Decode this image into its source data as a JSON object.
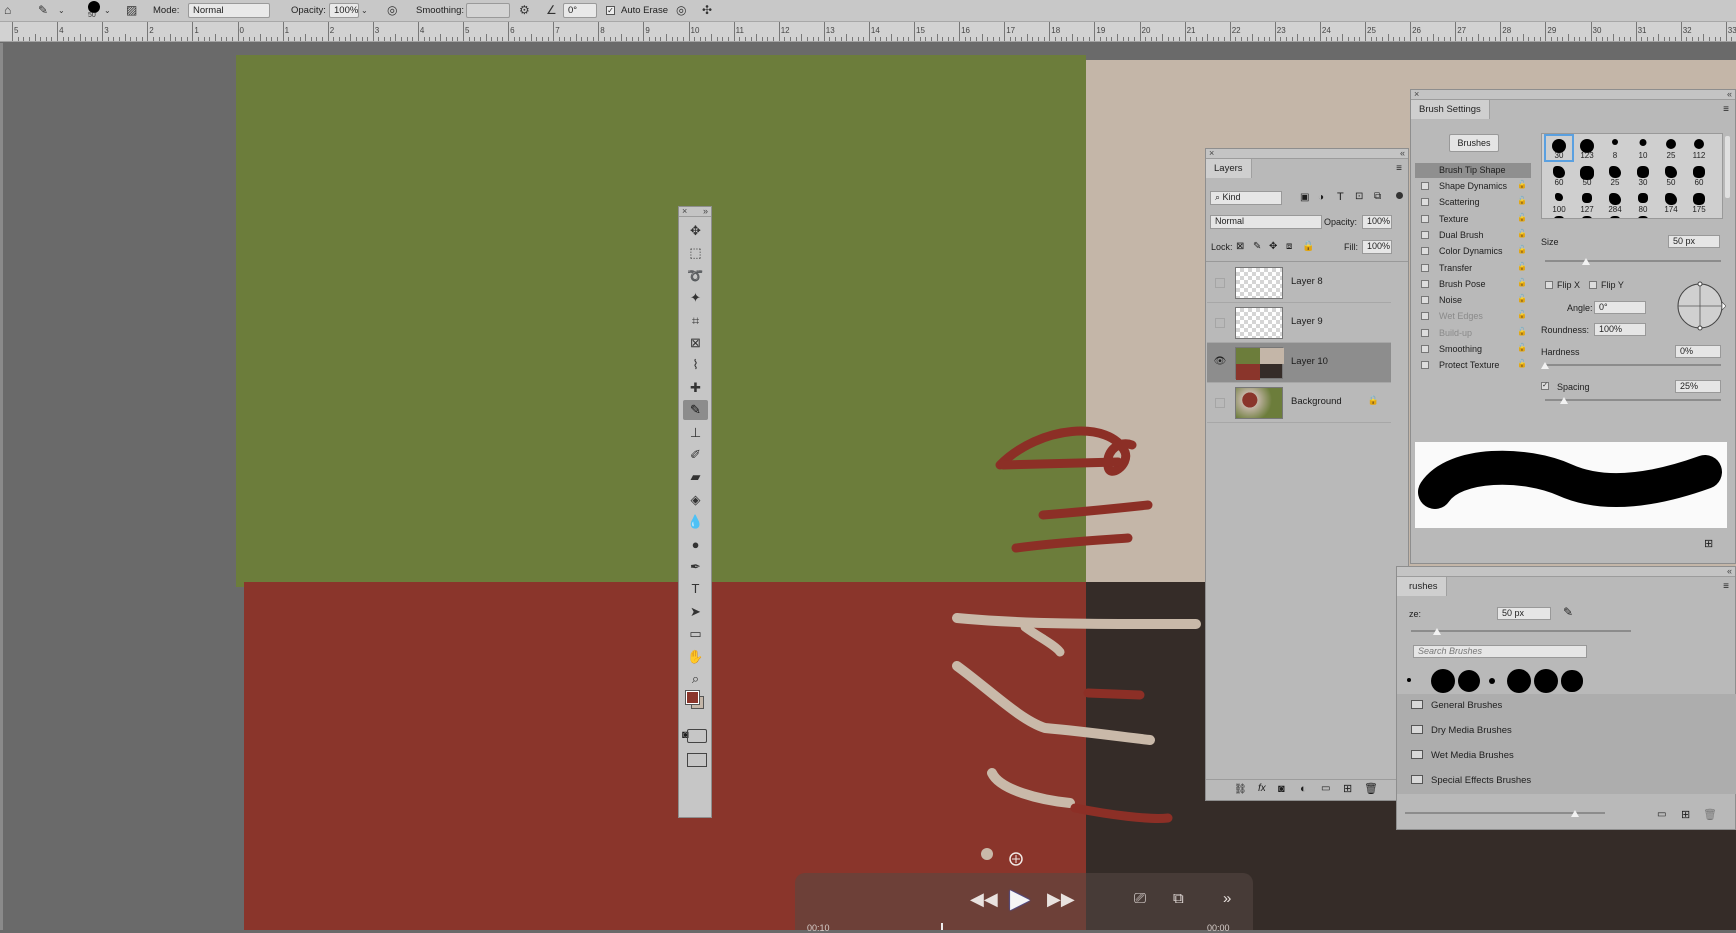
{
  "options_bar": {
    "brush_size": "50",
    "mode_label": "Mode:",
    "mode_value": "Normal",
    "opacity_label": "Opacity:",
    "opacity_value": "100%",
    "smoothing_label": "Smoothing:",
    "angle_value": "0°",
    "auto_erase_label": "Auto Erase"
  },
  "ruler": {
    "labels": [
      "5",
      "4",
      "3",
      "2",
      "1",
      "0",
      "1",
      "2",
      "3",
      "4",
      "5",
      "6",
      "7",
      "8",
      "9",
      "10",
      "11",
      "12",
      "13",
      "14",
      "15",
      "16",
      "17",
      "18",
      "19",
      "20",
      "21",
      "22",
      "23",
      "24",
      "25",
      "26",
      "27",
      "28",
      "29",
      "30",
      "31",
      "32",
      "33"
    ]
  },
  "canvas_colors": {
    "green": "#6c7d3b",
    "beige": "#c4b6a8",
    "red": "#8a352b",
    "dark": "#352c28",
    "stroke_red": "#8c2f26",
    "stroke_beige": "#c9b9a9"
  },
  "layers_panel": {
    "tab": "Layers",
    "filter_kind": "Kind",
    "blend_mode": "Normal",
    "opacity_label": "Opacity:",
    "opacity_value": "100%",
    "lock_label": "Lock:",
    "fill_label": "Fill:",
    "fill_value": "100%",
    "layers": [
      {
        "name": "Layer 8",
        "visible": false,
        "selected": false
      },
      {
        "name": "Layer 9",
        "visible": false,
        "selected": false
      },
      {
        "name": "Layer 10",
        "visible": true,
        "selected": true
      },
      {
        "name": "Background",
        "visible": false,
        "selected": false
      }
    ]
  },
  "brush_settings": {
    "tab": "Brush Settings",
    "brushes_button": "Brushes",
    "brush_tip_shape": "Brush Tip Shape",
    "options": [
      {
        "label": "Shape Dynamics",
        "dim": false
      },
      {
        "label": "Scattering",
        "dim": false
      },
      {
        "label": "Texture",
        "dim": false
      },
      {
        "label": "Dual Brush",
        "dim": false
      },
      {
        "label": "Color Dynamics",
        "dim": false
      },
      {
        "label": "Transfer",
        "dim": false
      },
      {
        "label": "Brush Pose",
        "dim": false
      },
      {
        "label": "Noise",
        "dim": false
      },
      {
        "label": "Wet Edges",
        "dim": true
      },
      {
        "label": "Build-up",
        "dim": true
      },
      {
        "label": "Smoothing",
        "dim": false
      },
      {
        "label": "Protect Texture",
        "dim": false
      }
    ],
    "tip_sizes": [
      "30",
      "123",
      "8",
      "10",
      "25",
      "112",
      "60",
      "50",
      "25",
      "30",
      "50",
      "60",
      "100",
      "127",
      "284",
      "80",
      "174",
      "175"
    ],
    "size_label": "Size",
    "size_value": "50 px",
    "flip_x": "Flip X",
    "flip_y": "Flip Y",
    "angle_label": "Angle:",
    "angle_value": "0°",
    "roundness_label": "Roundness:",
    "roundness_value": "100%",
    "hardness_label": "Hardness",
    "hardness_value": "0%",
    "spacing_label": "Spacing",
    "spacing_value": "25%"
  },
  "brushes_panel": {
    "tab": "rushes",
    "size_label": "ze:",
    "size_value": "50 px",
    "search_placeholder": "Search Brushes",
    "folders": [
      "General Brushes",
      "Dry Media Brushes",
      "Wet Media Brushes",
      "Special Effects Brushes"
    ]
  },
  "video_controls": {
    "time_left": "00:10",
    "time_right": "00:00"
  },
  "tools": [
    "move-tool",
    "marquee-tool",
    "lasso-tool",
    "magic-wand-tool",
    "crop-tool",
    "frame-tool",
    "eyedropper-tool",
    "healing-brush-tool",
    "pencil-tool",
    "stamp-tool",
    "history-brush-tool",
    "eraser-tool",
    "paint-bucket-tool",
    "blur-tool",
    "dodge-tool",
    "pen-tool",
    "type-tool",
    "path-selection-tool",
    "rectangle-tool",
    "hand-tool",
    "zoom-tool",
    "more-tools"
  ]
}
